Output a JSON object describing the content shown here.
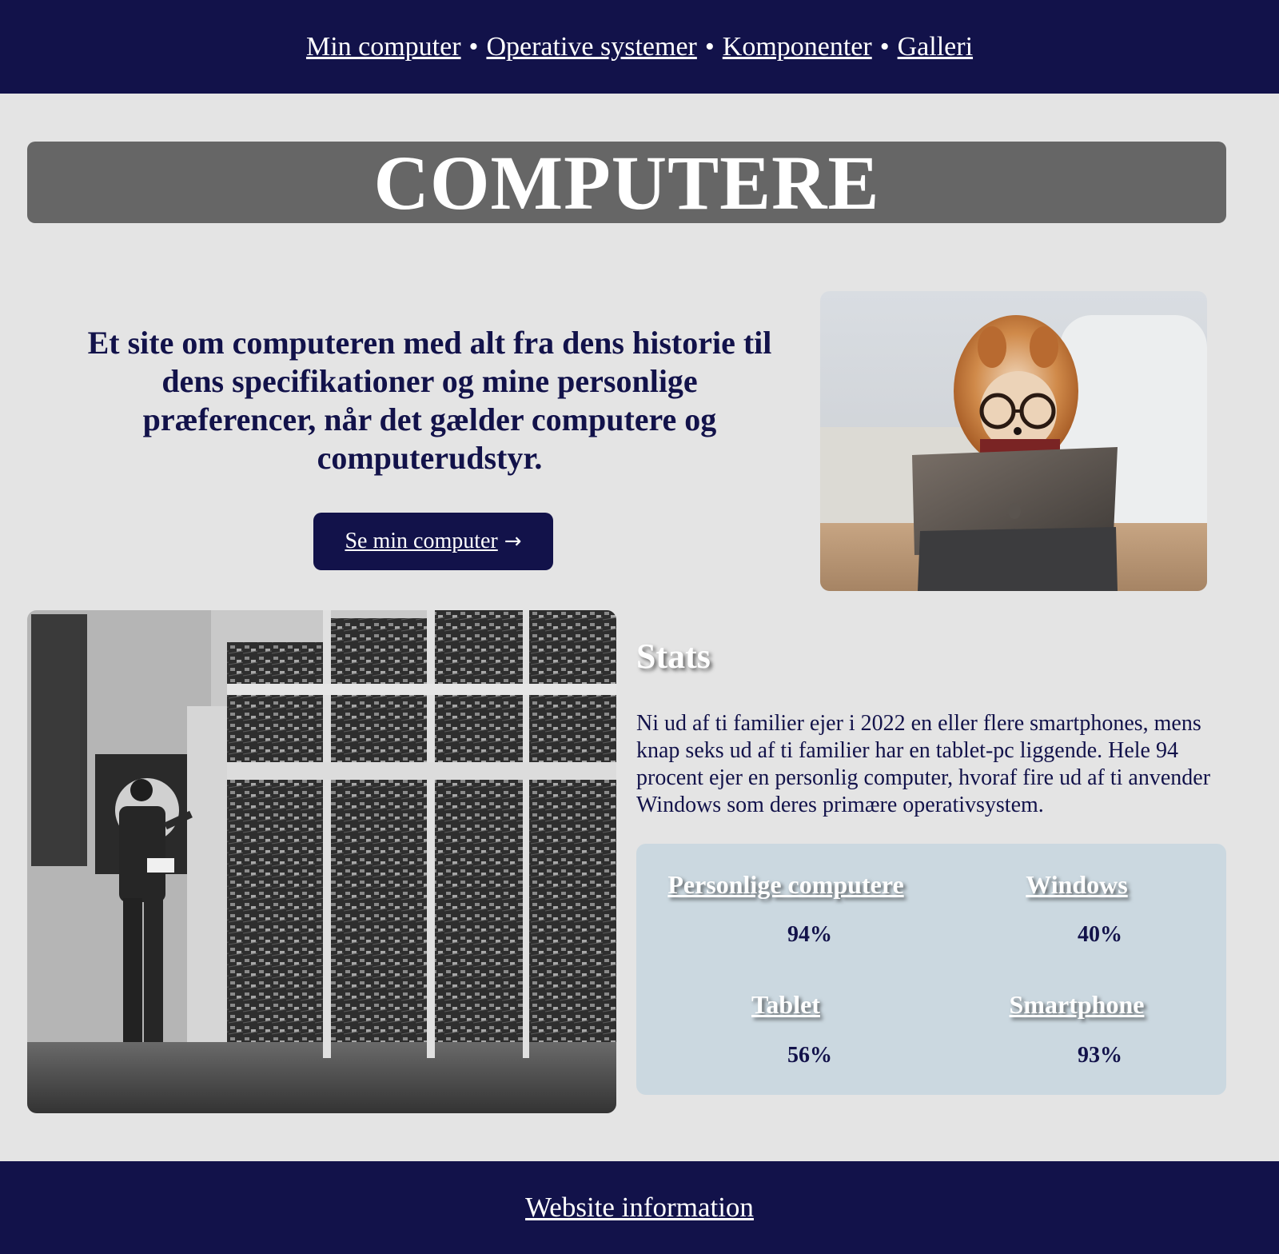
{
  "nav": {
    "items": [
      {
        "label": "Min computer"
      },
      {
        "label": "Operative systemer"
      },
      {
        "label": "Komponenter"
      },
      {
        "label": "Galleri"
      }
    ],
    "separator": "•"
  },
  "hero": {
    "title": "COMPUTERE",
    "intro": "Et site om computeren med alt fra dens historie til dens specifikationer og mine personlige præferencer, når det gælder computere og computerudstyr.",
    "cta_label": "Se min computer",
    "cta_arrow": "→"
  },
  "stats": {
    "title": "Stats",
    "text": "Ni ud af ti familier ejer i 2022 en eller flere smartphones, mens knap seks ud af ti familier har en tablet-pc liggende. Hele 94 procent ejer en personlig computer, hvoraf fire ud af ti anvender Windows som deres primære operativsystem.",
    "items": [
      {
        "label": "Personlige computere",
        "value": "94%"
      },
      {
        "label": "Windows",
        "value": "40%"
      },
      {
        "label": "Tablet",
        "value": "56%"
      },
      {
        "label": "Smartphone",
        "value": "93%"
      }
    ]
  },
  "footer": {
    "link": "Website information"
  },
  "colors": {
    "navy": "#12124a",
    "page_bg": "#e4e4e4",
    "title_bg": "#666666",
    "stats_box_bg": "#cbd8e0"
  }
}
